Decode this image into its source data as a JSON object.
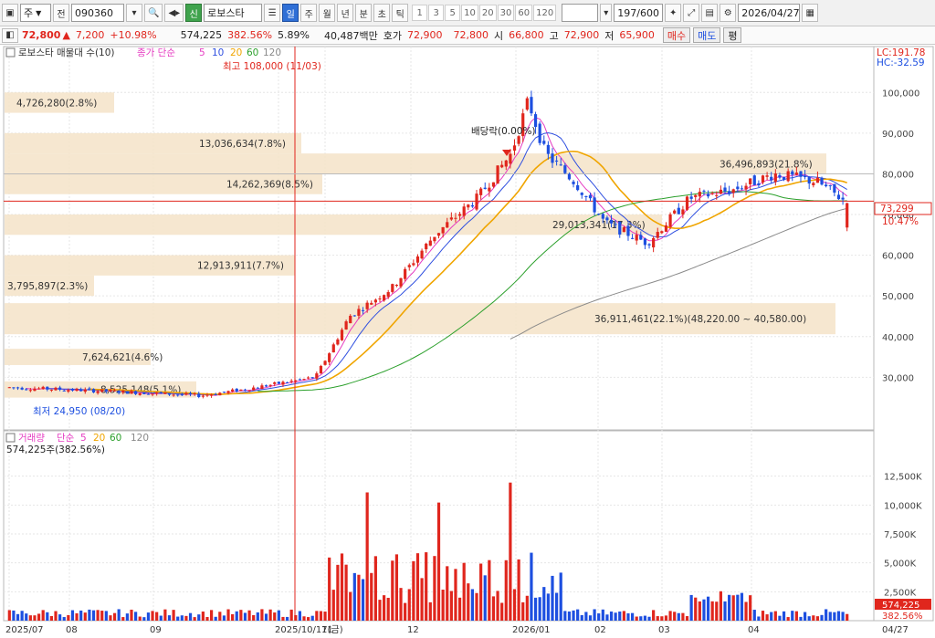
{
  "toolbar": {
    "market": "주",
    "prev_label": "전",
    "code": "090360",
    "stock_name": "로보스타",
    "badge_new": "신",
    "tf_day": "일",
    "tf_week": "주",
    "tf_month": "월",
    "tf_year": "년",
    "tf_min": "분",
    "tf_sec": "초",
    "tf_tick": "틱",
    "periods": [
      "1",
      "3",
      "5",
      "10",
      "20",
      "30",
      "60",
      "120"
    ],
    "count": "197",
    "count_total": "/600",
    "date": "2026/04/27"
  },
  "quote": {
    "price": "72,800",
    "change": "7,200",
    "change_pct": "+10.98%",
    "volume": "574,225",
    "volume_ratio": "382.56%",
    "turnover": "5.89%",
    "amount": "40,487백만",
    "ask_label": "호가",
    "ask": "72,900",
    "bid": "72,800",
    "open_label": "시",
    "open": "66,800",
    "high_label": "고",
    "high": "72,900",
    "low_label": "저",
    "low": "65,900",
    "buy_label": "매수",
    "sell_label": "매도",
    "eval_label": "평"
  },
  "price_panel": {
    "legend_title": "로보스타 매물대 수(10)",
    "ma_legend": "종가 단순",
    "ma_periods": [
      "5",
      "10",
      "20",
      "60",
      "120"
    ],
    "lc": "LC:191.78",
    "hc": "HC:-32.59",
    "high_note": "최고 108,000 (11/03)",
    "low_note": "최저 24,950 (08/20)",
    "dividend_note": "배당락(0.00%)",
    "current_price": "73,299",
    "current_pct": "10.47%"
  },
  "volume_panel": {
    "legend_title": "거래량",
    "ma_legend": "단순",
    "ma_periods": [
      "5",
      "20",
      "60",
      "120"
    ],
    "current": "574,225주(382.56%)",
    "current_value": "574,225",
    "current_pct": "382.56%"
  },
  "x_labels": [
    "2025/07",
    "08",
    "09",
    "2025/10/17(금)",
    "11",
    "12",
    "2026/01",
    "02",
    "03",
    "04",
    "04/27"
  ],
  "price_ticks": [
    "100,000",
    "90,000",
    "80,000",
    "70,000",
    "60,000",
    "50,000",
    "40,000",
    "30,000"
  ],
  "volume_ticks": [
    "12,500K",
    "10,000K",
    "7,500K",
    "5,000K",
    "2,500K"
  ],
  "volume_profile": [
    {
      "label": "4,726,280(2.8%)",
      "low": 95000,
      "high": 100000
    },
    {
      "label": "13,036,634(7.8%)",
      "low": 85000,
      "high": 90000
    },
    {
      "label": "36,496,893(21.8%)",
      "low": 80000,
      "high": 85000
    },
    {
      "label": "14,262,369(8.5%)",
      "low": 75000,
      "high": 80000
    },
    {
      "label": "29,013,341(17.3%)",
      "low": 65000,
      "high": 70000
    },
    {
      "label": "12,913,911(7.7%)",
      "low": 55000,
      "high": 60000
    },
    {
      "label": "3,795,897(2.3%)",
      "low": 50000,
      "high": 55000
    },
    {
      "label": "36,911,461(22.1%)(48,220.00 ~ 40,580.00)",
      "low": 40580,
      "high": 48220
    },
    {
      "label": "7,624,621(4.6%)",
      "low": 33000,
      "high": 37000
    },
    {
      "label": "8,525,148(5.1%)",
      "low": 25000,
      "high": 29000
    }
  ],
  "colors": {
    "up": "#e0261d",
    "down": "#1d4fe0",
    "ma5": "#e63cc2",
    "ma10": "#3050e0",
    "ma20": "#f0a500",
    "ma60": "#2ca02c",
    "ma120": "#8a8a8a",
    "profile": "#f5e3c8"
  }
}
